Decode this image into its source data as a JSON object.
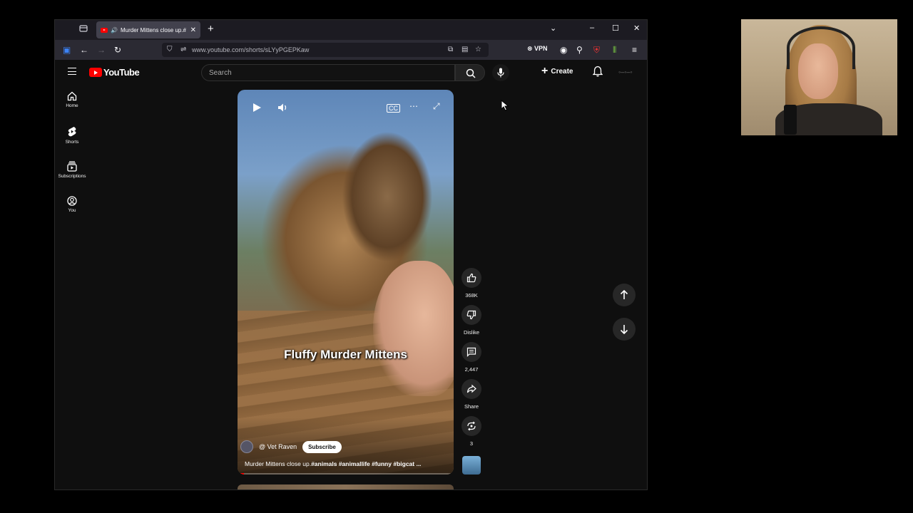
{
  "browser": {
    "tab_title": "Murder Mittens close up.#",
    "url": "www.youtube.com/shorts/sLYyPGEPKaw",
    "vpn_label": "VPN"
  },
  "youtube": {
    "logo_text": "YouTube",
    "search_placeholder": "Search",
    "create_label": "Create",
    "guide": [
      {
        "label": "Home",
        "icon": "home-icon"
      },
      {
        "label": "Shorts",
        "icon": "shorts-icon"
      },
      {
        "label": "Subscriptions",
        "icon": "subscriptions-icon"
      },
      {
        "label": "You",
        "icon": "you-icon"
      }
    ]
  },
  "short": {
    "caption": "Fluffy Murder Mittens",
    "channel": "@ Vet Raven",
    "subscribe_label": "Subscribe",
    "title_plain": "Murder Mittens close up.",
    "title_tags": "#animals #animallife #funny #bigcat ...",
    "likes": "368K",
    "dislike_label": "Dislike",
    "comments": "2,447",
    "share_label": "Share",
    "remix_count": "3",
    "progress": 0.03
  },
  "colors": {
    "brand_red": "#ff0000",
    "page_bg": "#0f0f0f",
    "chip_bg": "#272727"
  }
}
